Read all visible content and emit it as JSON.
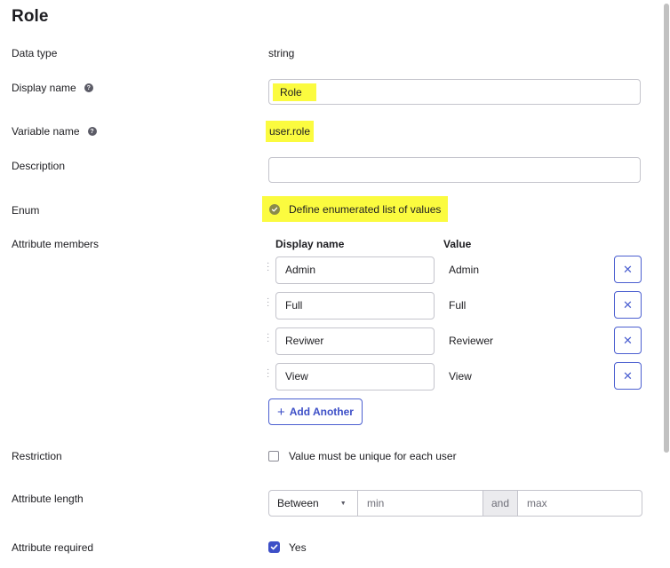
{
  "title": "Role",
  "fields": {
    "data_type": {
      "label": "Data type",
      "value": "string"
    },
    "display_name": {
      "label": "Display name",
      "value": "Role"
    },
    "variable_name": {
      "label": "Variable name",
      "value": "user.role"
    },
    "description": {
      "label": "Description",
      "value": ""
    },
    "enum": {
      "label": "Enum",
      "checkbox_label": "Define enumerated list of values",
      "checked": true
    },
    "attribute_members": {
      "label": "Attribute members",
      "col_display": "Display name",
      "col_value": "Value",
      "rows": [
        {
          "display": "Admin",
          "value": "Admin"
        },
        {
          "display": "Full",
          "value": "Full"
        },
        {
          "display": "Reviwer",
          "value": "Reviewer"
        },
        {
          "display": "View",
          "value": "View"
        }
      ],
      "add_label": "Add Another"
    },
    "restriction": {
      "label": "Restriction",
      "checkbox_label": "Value must be unique for each user",
      "checked": false
    },
    "attribute_length": {
      "label": "Attribute length",
      "select_value": "Between",
      "min_placeholder": "min",
      "and_label": "and",
      "max_placeholder": "max"
    },
    "attribute_required": {
      "label": "Attribute required",
      "checkbox_label": "Yes",
      "checked": true
    }
  },
  "icons": {
    "help": "question-circle-icon",
    "remove": "close-icon",
    "add": "plus-icon",
    "check": "checkmark-icon",
    "drag": "drag-handle-icon",
    "caret": "caret-down-icon"
  },
  "colors": {
    "accent": "#3d4fc7",
    "highlight": "#fbfb3f"
  }
}
